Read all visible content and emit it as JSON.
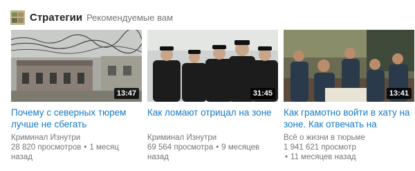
{
  "shelf": {
    "title": "Стратегии",
    "subtitle": "Рекомендуемые вам",
    "avatar_icon": "channel-avatar-icon"
  },
  "videos": [
    {
      "title": "Почему с северных тюрем лучше не сбегать",
      "channel": "Криминал Изнутри",
      "views": "28 820 просмотров",
      "age": "1 месяц назад",
      "duration": "13:47"
    },
    {
      "title": "Как ломают отрицал на зоне",
      "channel": "Криминал Изнутри",
      "views": "69 564 просмотра",
      "age": "9 месяцев назад",
      "duration": "31:45"
    },
    {
      "title": "Как грамотно войти в хату на зоне. Как отвечать на",
      "channel": "Всё о жизни в тюрьме",
      "views": "1 941 621 просмотр",
      "age": "11 месяцев назад",
      "duration": "13:41"
    }
  ],
  "colors": {
    "link": "#167ac6",
    "meta": "#767676",
    "title": "#222222"
  }
}
